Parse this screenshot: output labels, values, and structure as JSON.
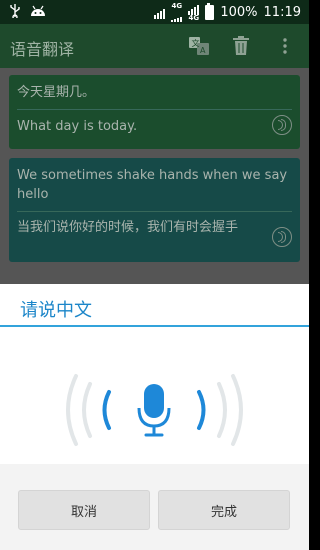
{
  "status_bar": {
    "network_top": "4G",
    "network_bottom": "4G",
    "battery_percent": "100%",
    "time": "11:19"
  },
  "app_bar": {
    "title": "语音翻译",
    "icons": [
      "translate-icon",
      "trash-icon",
      "more-vert-icon"
    ]
  },
  "conversation": [
    {
      "source_text": "今天星期几。",
      "translated_text": "What day is today."
    },
    {
      "source_text": "We sometimes shake hands when we say hello",
      "translated_text": "当我们说你好的时候，我们有时会握手"
    }
  ],
  "dialog": {
    "title": "请说中文",
    "cancel_label": "取消",
    "done_label": "完成"
  },
  "colors": {
    "accent": "#1c86c9",
    "mic": "#1e88d8",
    "wave_inner": "#1e88d8",
    "wave_outer": "#e2e6e8"
  }
}
